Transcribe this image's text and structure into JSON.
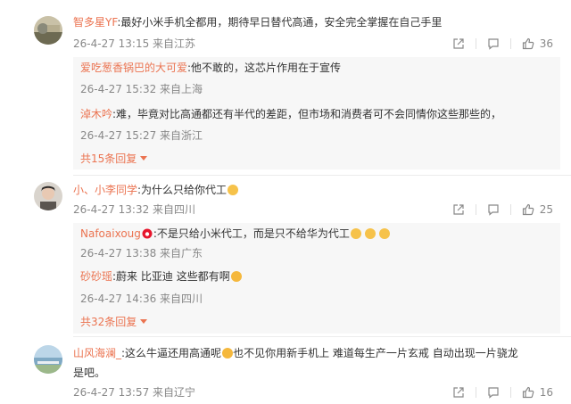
{
  "comments": [
    {
      "user": "智多星YF",
      "text": ":最好小米手机全都用，期待早日替代高通，安全完全掌握在自己手里",
      "time": "26-4-27 13:15 来自江苏",
      "likes": "36",
      "replies": [
        {
          "user": "爱吃葱香锅巴的大可爱",
          "text": ":他不敢的，这芯片作用在于宣传",
          "time": "26-4-27 15:32 来自上海"
        },
        {
          "user": "淖木吟",
          "text": ":难，毕竟对比高通都还有半代的差距，但市场和消费者可不会同情你这些那些的，",
          "time": "26-4-27 15:27 来自浙江"
        }
      ],
      "more_replies": "共15条回复"
    },
    {
      "user": "小、小李同学",
      "text": ":为什么只给你代工",
      "time": "26-4-27 13:32 来自四川",
      "likes": "25",
      "replies": [
        {
          "user": "Nafoaixoug",
          "text": ":不是只给小米代工，而是只不给华为代工",
          "time": "26-4-27 13:38 来自广东"
        },
        {
          "user": "砂砂瑶",
          "text": ":蔚来 比亚迪 这些都有啊",
          "time": "26-4-27 14:36 来自四川"
        }
      ],
      "more_replies": "共32条回复"
    },
    {
      "user": "山风海澜_",
      "text_a": ":这么牛逼还用高通呢",
      "text_b": "也不见你用新手机上  难道每生产一片玄戒 自动出现一片骁龙",
      "text_c": "是吧。",
      "time": "26-4-27 13:57 来自辽宁",
      "likes": "16"
    }
  ],
  "colors": {
    "username": "#eb7350",
    "meta": "#888888",
    "reply_bg": "#f7f7f7"
  },
  "icons": [
    "share-icon",
    "comment-icon",
    "like-icon",
    "caret-down-icon"
  ]
}
